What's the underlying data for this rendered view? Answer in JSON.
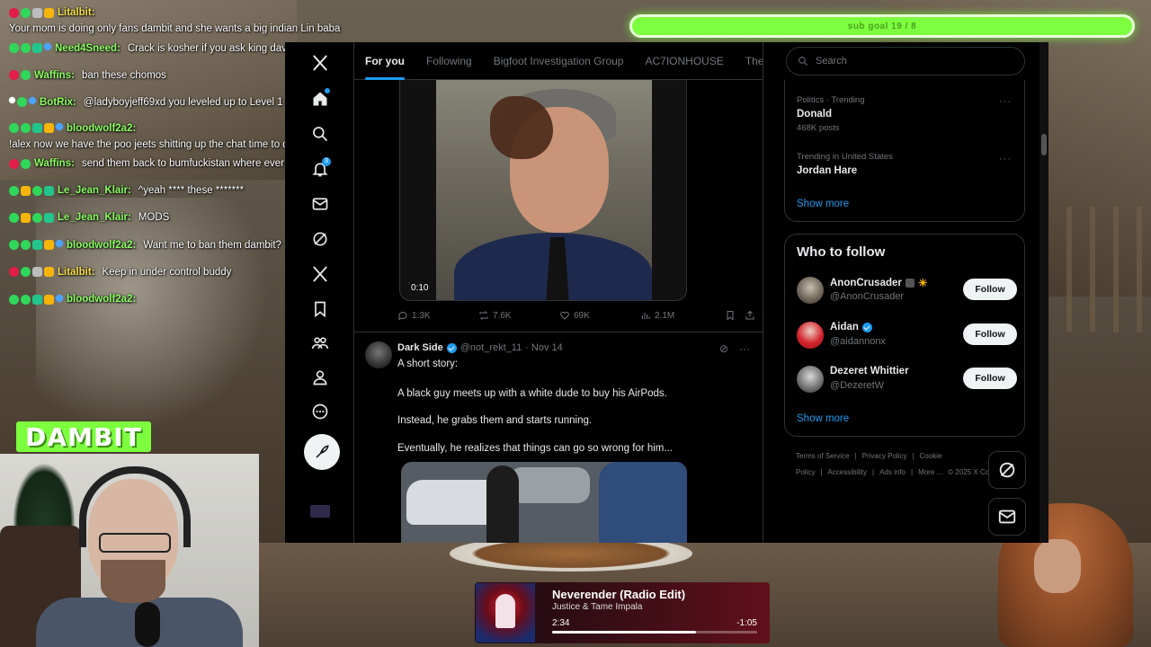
{
  "stream": {
    "sub_goal": "sub goal 19 / 8",
    "logo_text": "DAMBIT"
  },
  "chat": [
    {
      "user": "Litalbit",
      "text": "",
      "full": "Your mom is doing only fans dambit and she wants a big indian Lin baba",
      "color": "#f7e04a"
    },
    {
      "user": "Need4Sneed",
      "text": "Crack is kosher if you ask king dave",
      "color": "#8cff62"
    },
    {
      "user": "Waffins",
      "text": "ban these chomos",
      "color": "#8cff62"
    },
    {
      "user": "BotRix",
      "text": "@ladyboyjeff69xd you leveled up to Level 1",
      "color": "#8cff62"
    },
    {
      "user": "bloodwolf2a2",
      "text": "",
      "full": "!alex now we have the poo jeets shitting up the chat time to deport!",
      "color": "#8cff62"
    },
    {
      "user": "Waffins",
      "text": "send them back to bumfuckistan where ever they comefrom",
      "color": "#8cff62"
    },
    {
      "user": "Le_Jean_Klair",
      "text": "^yeah **** these *******",
      "color": "#8cff62"
    },
    {
      "user": "Le_Jean_Klair",
      "text": "MODS",
      "color": "#8cff62"
    },
    {
      "user": "bloodwolf2a2",
      "text": "Want me to ban them dambit?",
      "color": "#8cff62"
    },
    {
      "user": "Litalbit",
      "text": "Keep in under control buddy",
      "color": "#f7e04a"
    },
    {
      "user": "bloodwolf2a2",
      "text": "",
      "color": "#8cff62"
    }
  ],
  "x": {
    "nav": {
      "notifications_badge": "3"
    },
    "tabs": [
      "For you",
      "Following",
      "Bigfoot Investigation Group",
      "AC7IONHOUSE",
      "The l"
    ],
    "video_post": {
      "duration": "0:10",
      "replies": "1.3K",
      "reposts": "7.6K",
      "likes": "69K",
      "views": "2.1M"
    },
    "post2": {
      "name": "Dark Side",
      "handle": "@not_rekt_11",
      "date": "· Nov 14",
      "lines": [
        "A short story:",
        "A black guy meets up with a white dude to buy his AirPods.",
        "Instead, he grabs them and starts running.",
        "Eventually, he realizes that things can go so wrong for him..."
      ]
    },
    "search_placeholder": "Search",
    "trends": [
      {
        "category": "Politics · Trending",
        "name": "Donald",
        "count": "468K posts"
      },
      {
        "category": "Trending in United States",
        "name": "Jordan Hare",
        "count": ""
      }
    ],
    "show_more": "Show more",
    "who_to_follow": {
      "title": "Who to follow",
      "follow_label": "Follow",
      "accounts": [
        {
          "name": "AnonCrusader",
          "handle": "@AnonCrusader"
        },
        {
          "name": "Aidan",
          "handle": "@aidannonx"
        },
        {
          "name": "Dezeret Whittier",
          "handle": "@DezeretW"
        }
      ]
    },
    "footer": [
      "Terms of Service",
      "|",
      "Privacy Policy",
      "|",
      "Cookie Policy",
      "|",
      "Accessibility",
      "|",
      "Ads info",
      "|",
      "More ...",
      "© 2025 X Corp."
    ]
  },
  "player": {
    "title": "Neverender (Radio Edit)",
    "artist": "Justice & Tame Impala",
    "elapsed": "2:34",
    "remaining": "-1:05",
    "progress": 0.7
  },
  "colors": {
    "accent": "#1d9bf0",
    "goal": "#7dff3f"
  }
}
